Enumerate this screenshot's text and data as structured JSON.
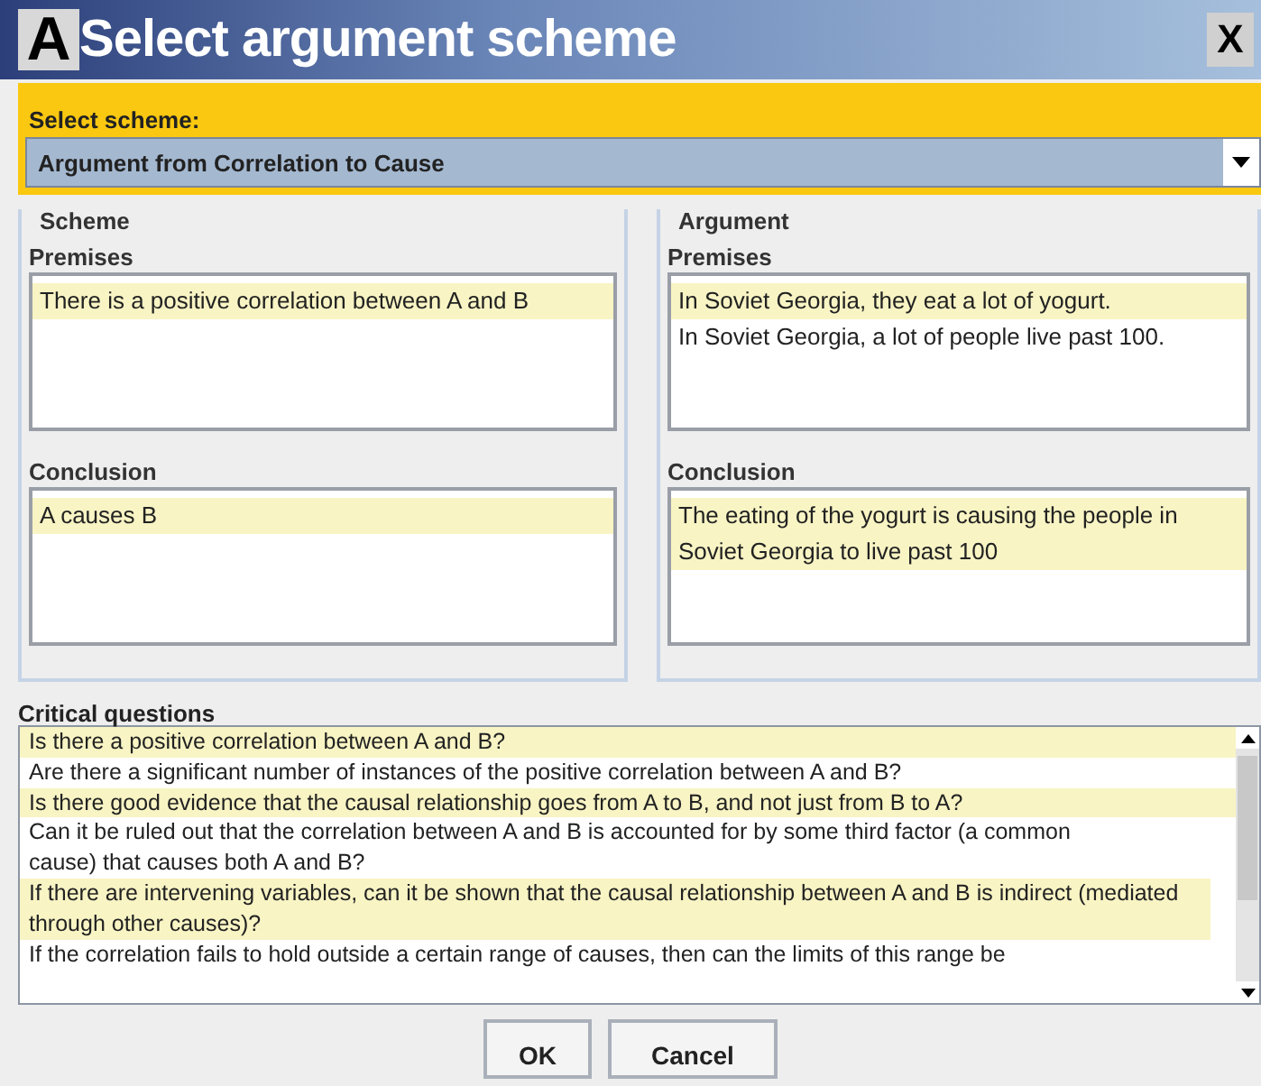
{
  "window": {
    "icon_letter": "A",
    "title": "Select argument scheme",
    "close": "X"
  },
  "scheme_selector": {
    "label": "Select scheme:",
    "value": "Argument from Correlation to Cause"
  },
  "panels": [
    {
      "title": "Scheme",
      "premises_label": "Premises",
      "premises": [
        "There is a positive correlation between A and B"
      ],
      "conclusion_label": "Conclusion",
      "conclusion": "A causes B"
    },
    {
      "title": "Argument",
      "premises_label": "Premises",
      "premises": [
        "In Soviet Georgia, they eat a lot of yogurt.",
        "In Soviet Georgia, a lot of people live past 100."
      ],
      "conclusion_label": "Conclusion",
      "conclusion": "The eating of the yogurt is causing the people in Soviet Georgia to live past 100"
    }
  ],
  "critical_questions": {
    "label": "Critical questions",
    "items": [
      "Is there a positive correlation between A and B?",
      "Are there a significant number of instances of the positive correlation between A and B?",
      "Is there good evidence that the causal relationship goes from A to B, and not just from B to A?",
      "Can it be ruled out that the correlation between A and B is accounted for by some third factor (a common cause) that causes both A and B?",
      "If there are intervening variables, can it be shown that the causal relationship between A and B is indirect (mediated through other causes)?",
      "If the correlation fails to hold outside a certain range of causes, then can the limits of this range be"
    ]
  },
  "buttons": [
    "OK",
    "Cancel"
  ]
}
